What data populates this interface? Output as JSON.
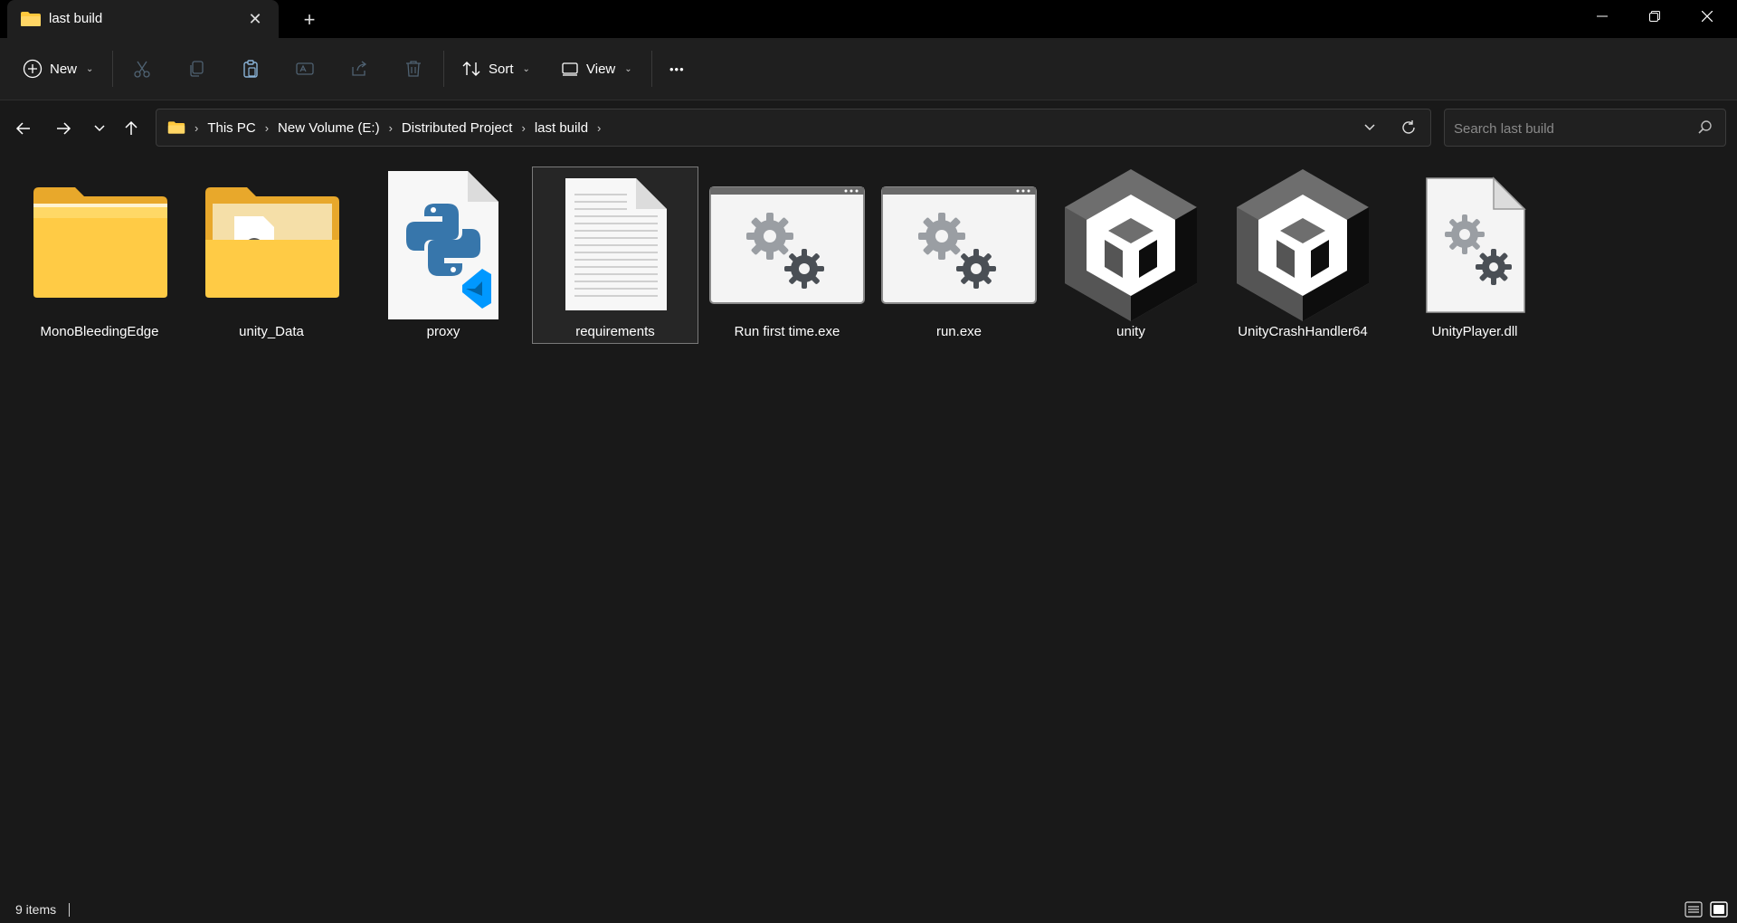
{
  "window": {
    "tab_title": "last build",
    "new_tab": "+",
    "close_tab": "✕"
  },
  "commands": {
    "new_label": "New",
    "sort_label": "Sort",
    "view_label": "View",
    "more_label": "•••"
  },
  "address": {
    "crumbs": [
      "This PC",
      "New Volume (E:)",
      "Distributed Project",
      "last build"
    ],
    "separator": "›"
  },
  "search": {
    "placeholder": "Search last build"
  },
  "items": [
    {
      "name": "MonoBleedingEdge",
      "icon": "folder-icon"
    },
    {
      "name": "unity_Data",
      "icon": "folder-with-file-icon"
    },
    {
      "name": "proxy",
      "icon": "python-file-icon"
    },
    {
      "name": "requirements",
      "icon": "text-document-icon",
      "selected": true
    },
    {
      "name": "Run first time.exe",
      "icon": "exe-app-icon"
    },
    {
      "name": "run.exe",
      "icon": "exe-app-icon"
    },
    {
      "name": "unity",
      "icon": "unity-icon"
    },
    {
      "name": "UnityCrashHandler64",
      "icon": "unity-icon"
    },
    {
      "name": "UnityPlayer.dll",
      "icon": "dll-file-icon"
    }
  ],
  "status": {
    "item_count": "9 items"
  },
  "colors": {
    "background": "#191919",
    "folder_yellow": "#FFC83D",
    "python_blue": "#3776AB",
    "vscode_blue": "#0098FF",
    "unity_gray": "#6e6e6e"
  }
}
